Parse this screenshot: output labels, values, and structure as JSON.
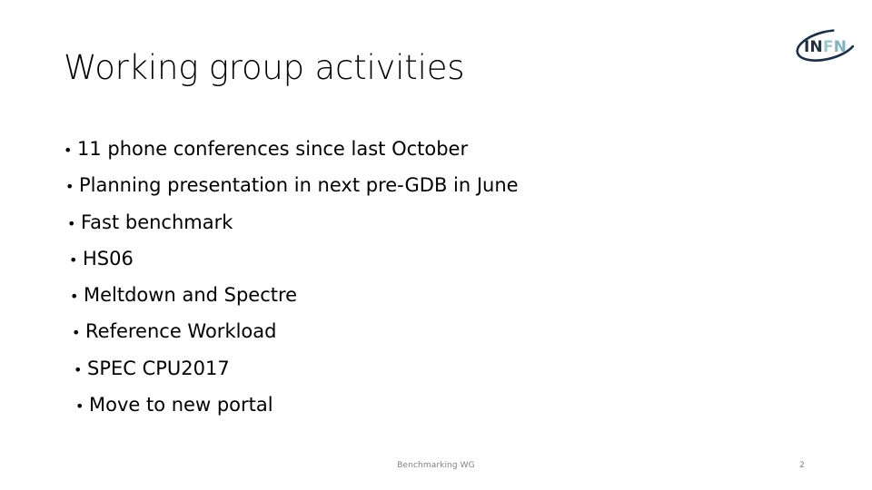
{
  "slide": {
    "title": "Working group activities",
    "bullets": [
      {
        "marker": "•",
        "text": "11 phone conferences since last October"
      },
      {
        "marker": "•",
        "text": "Planning presentation in next pre-GDB in June"
      },
      {
        "marker": "•",
        "text": "Fast benchmark"
      },
      {
        "marker": "•",
        "text": "HS06"
      },
      {
        "marker": "•",
        "text": "Meltdown and Spectre"
      },
      {
        "marker": "•",
        "text": "Reference Workload"
      },
      {
        "marker": "•",
        "text": "SPEC CPU2017"
      },
      {
        "marker": "•",
        "text": "Move to new portal"
      }
    ],
    "footer": {
      "text": "Benchmarking WG",
      "page_number": "2"
    },
    "logo": {
      "name": "infn-logo",
      "text": "INFN",
      "ring_color": "#1b2f45",
      "text_color_dark": "#1b2f45",
      "text_color_light": "#9fc6cf"
    },
    "colors": {
      "background": "#ffffff",
      "title": "#000000",
      "body": "#000000",
      "footer": "#808080"
    }
  }
}
